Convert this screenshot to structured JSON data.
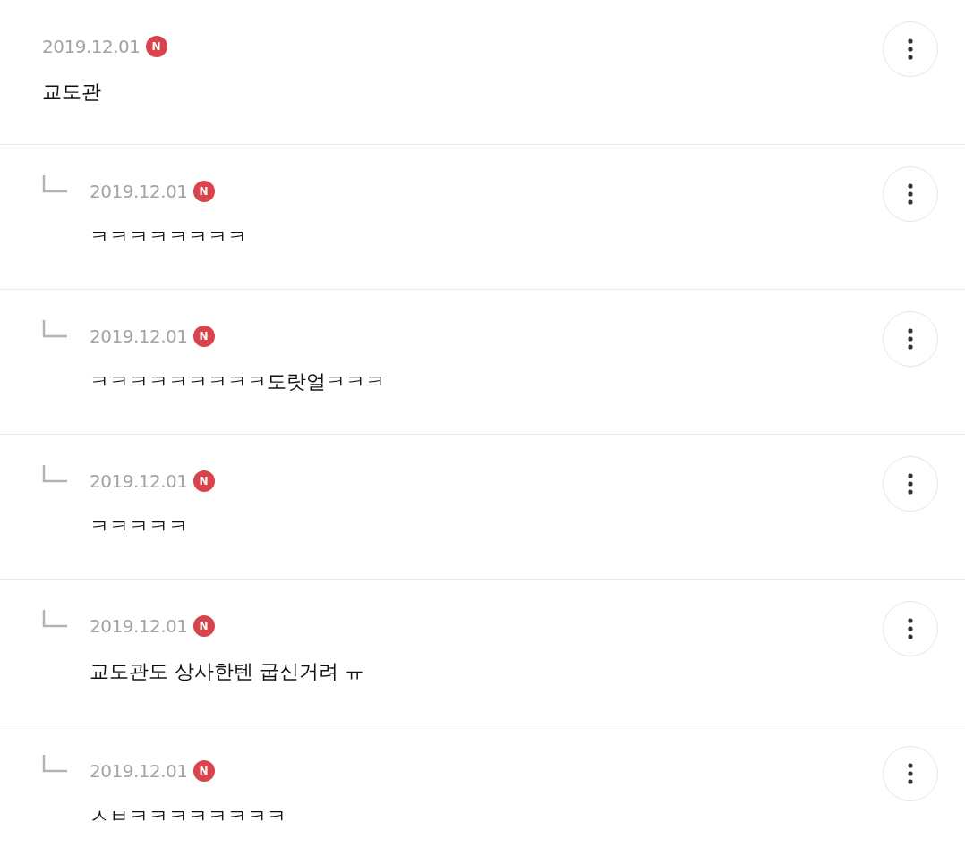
{
  "comments": [
    {
      "reply": false,
      "date": "2019.12.01",
      "badge": "N",
      "text": "교도관"
    },
    {
      "reply": true,
      "date": "2019.12.01",
      "badge": "N",
      "text": "ㅋㅋㅋㅋㅋㅋㅋㅋ"
    },
    {
      "reply": true,
      "date": "2019.12.01",
      "badge": "N",
      "text": "ㅋㅋㅋㅋㅋㅋㅋㅋㅋ도랏얼ㅋㅋㅋ"
    },
    {
      "reply": true,
      "date": "2019.12.01",
      "badge": "N",
      "text": "ㅋㅋㅋㅋㅋ"
    },
    {
      "reply": true,
      "date": "2019.12.01",
      "badge": "N",
      "text": "교도관도 상사한텐 굽신거려 ㅠ"
    },
    {
      "reply": true,
      "date": "2019.12.01",
      "badge": "N",
      "text": "ㅅㅂㅋㅋㅋㅋㅋㅋㅋㅋ"
    }
  ]
}
